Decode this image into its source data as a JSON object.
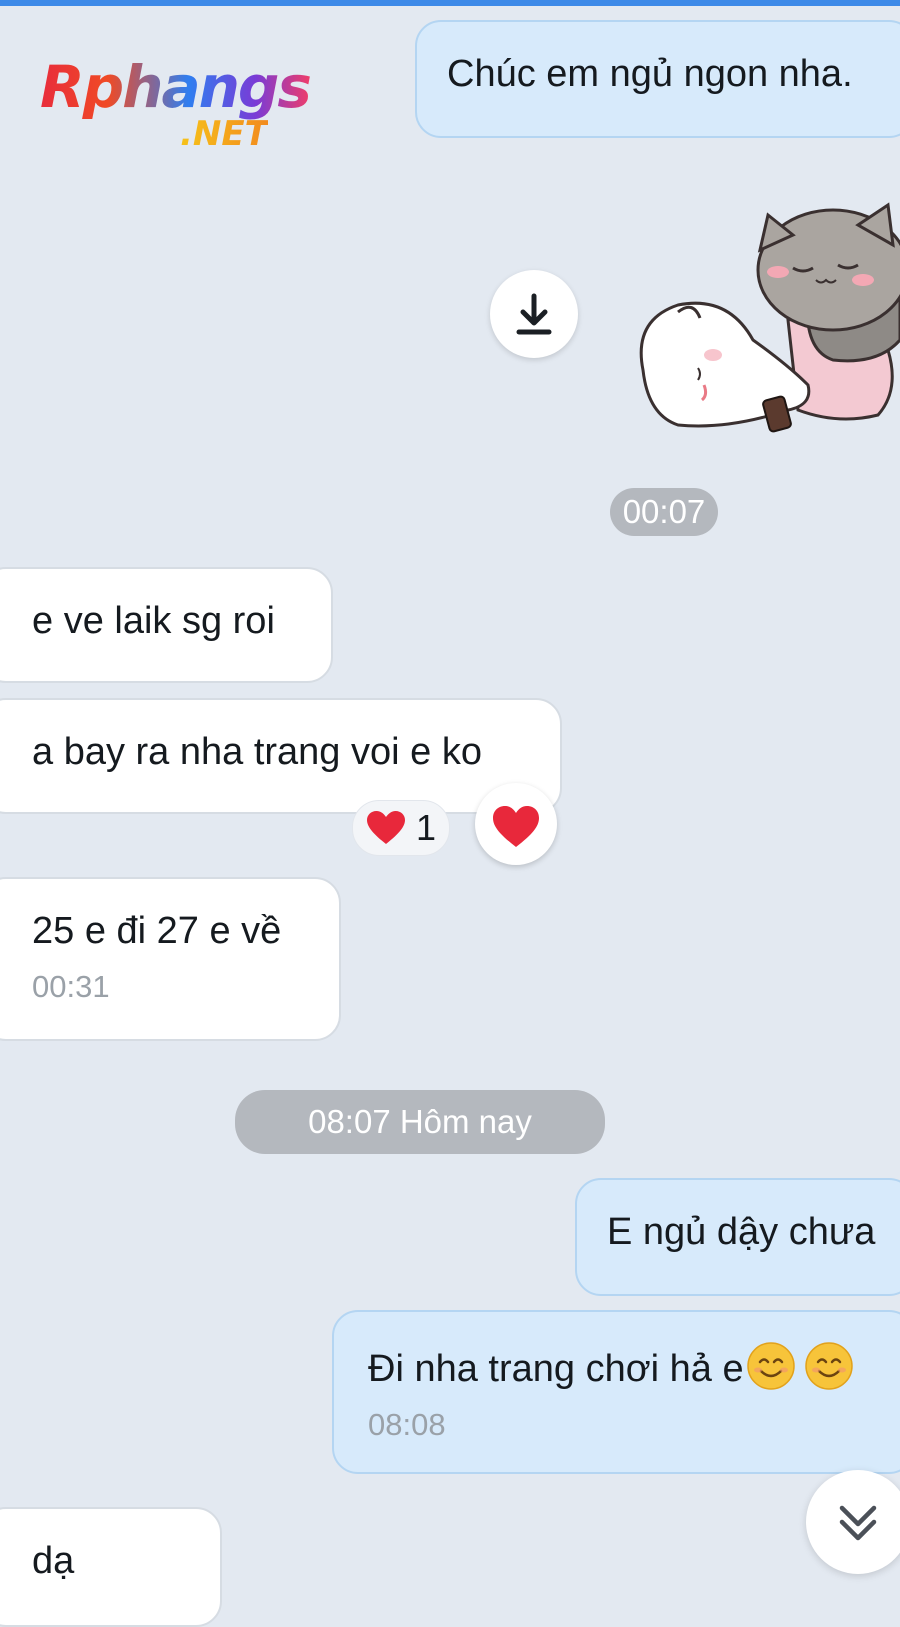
{
  "watermark": {
    "brand": "Rphangs",
    "domain": ".NET"
  },
  "messages": {
    "m1": {
      "text": "Chúc em ngủ ngon nha."
    },
    "sticker_time": "00:07",
    "m2": {
      "text": "e ve laik sg roi"
    },
    "m3": {
      "text": "a bay ra nha trang voi e ko",
      "reaction_count": "1"
    },
    "m4": {
      "text": "25 e đi 27 e về",
      "time": "00:31"
    },
    "day_divider": "08:07 Hôm nay",
    "m5": {
      "text": "E ngủ dậy chưa"
    },
    "m6": {
      "text": "Đi nha trang chơi hả e",
      "time": "08:08"
    },
    "m7": {
      "text": "dạ"
    }
  },
  "icons": {
    "download": "download-icon",
    "sticker": "sleeping-cats-sticker",
    "reaction": "red-heart-icon",
    "emoji": "smiling-face-icon",
    "scroll": "double-chevron-down-icon"
  },
  "colors": {
    "background": "#e3e9f1",
    "outgoing_bubble": "#d7eafb",
    "incoming_bubble": "#ffffff",
    "accent": "#3d8ae8",
    "heart": "#e8283b"
  }
}
